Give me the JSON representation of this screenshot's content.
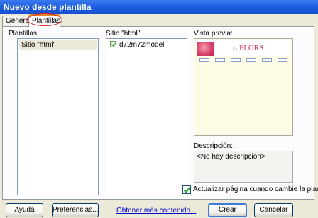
{
  "window": {
    "title": "Nuevo desde plantilla"
  },
  "tabs": [
    {
      "label": "General",
      "active": false
    },
    {
      "label": "Plantillas",
      "active": true
    }
  ],
  "templates": {
    "label": "Plantillas",
    "items": [
      {
        "label": "Sitio \"html\"",
        "selected": true
      }
    ]
  },
  "site": {
    "label": "Sitio \"html\":",
    "items": [
      {
        "label": "d72m72model",
        "icon": "template-file-icon"
      }
    ]
  },
  "preview": {
    "label": "Vista previa:",
    "thumbnail_text": {
      "small": "La",
      "brand": "FLORS"
    }
  },
  "description": {
    "label": "Descripción:",
    "value": "<No hay descripción>"
  },
  "update_checkbox": {
    "label": "Actualizar página cuando cambie la plantilla",
    "checked": true
  },
  "footer": {
    "help_label": "Ayuda",
    "prefs_label": "Preferencias...",
    "link_label": "Obtener más contenido...",
    "create_label": "Crear",
    "cancel_label": "Cancelar"
  },
  "colors": {
    "titlebar": "#1f5fe0",
    "highlight_circle": "#dd2222",
    "link": "#0000cc"
  }
}
